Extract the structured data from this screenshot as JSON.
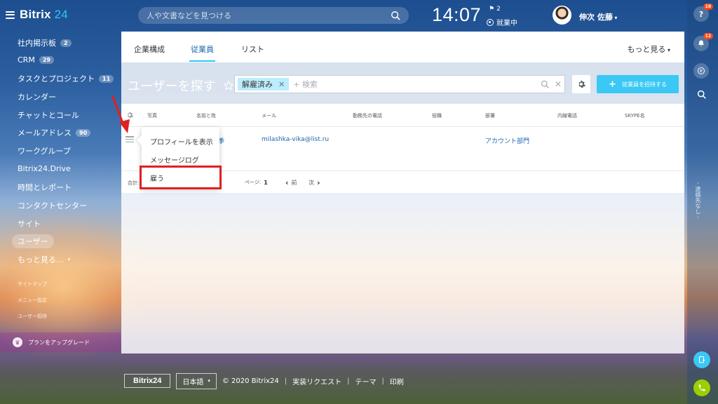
{
  "header": {
    "logo_main": "Bitrix",
    "logo_num": "24",
    "search_placeholder": "人や文書などを見つける",
    "clock": "14:07",
    "flag_count": "2",
    "work_status": "就業中",
    "user_name": "伸次 佐藤"
  },
  "left_menu": {
    "items": [
      {
        "label": "社内掲示板",
        "counter": "2"
      },
      {
        "label": "CRM",
        "counter": "29"
      },
      {
        "label": "タスクとプロジェクト",
        "counter": "11"
      },
      {
        "label": "カレンダー"
      },
      {
        "label": "チャットとコール"
      },
      {
        "label": "メールアドレス",
        "counter": "90"
      },
      {
        "label": "ワークグループ"
      },
      {
        "label": "Bitrix24.Drive"
      },
      {
        "label": "時間とレポート"
      },
      {
        "label": "コンタクトセンター"
      },
      {
        "label": "サイト"
      },
      {
        "label": "ユーザー"
      },
      {
        "label": "もっと見る..."
      }
    ],
    "small_items": [
      "サイトマップ",
      "メニュー設定",
      "ユーザー招待"
    ],
    "upgrade_label": "プランをアップグレード"
  },
  "tabs": {
    "items": [
      "企業構成",
      "従業員",
      "リスト"
    ],
    "more": "もっと見る"
  },
  "toolbar": {
    "page_title": "ユーザーを探す",
    "filter_tag": "解雇済み",
    "filter_placeholder": "+ 検索",
    "invite_label": "従業員を招待する"
  },
  "grid": {
    "columns": [
      "写真",
      "名前と姓",
      "メール",
      "勤務先の電話",
      "役職",
      "部署",
      "内線電話",
      "SKYPE名"
    ],
    "row": {
      "name_fragment": "季",
      "email": "milashka-vika@list.ru",
      "department": "アカウント部門"
    },
    "total_label": "合計:",
    "page_label": "ページ:",
    "page_number": "1",
    "prev": "前",
    "next": "次"
  },
  "context_menu": {
    "items": [
      "プロフィールを表示",
      "メッセージログ",
      "雇う"
    ]
  },
  "right_bar": {
    "help_badge": "18",
    "notify_badge": "12",
    "vertical_label": "- 連絡先なし -"
  },
  "footer": {
    "logo": "Bitrix24",
    "lang": "日本語",
    "copyright": "© 2020 Bitrix24",
    "links": [
      "実装リクエスト",
      "テーマ",
      "印刷"
    ]
  },
  "colors": {
    "accent": "#2fc6f6",
    "link": "#2067b0",
    "highlight": "#e02020",
    "badge": "#f54819"
  }
}
